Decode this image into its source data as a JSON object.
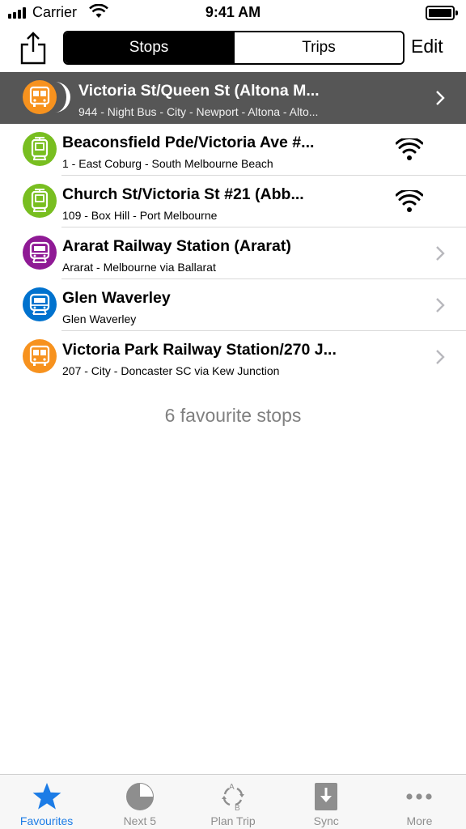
{
  "status_bar": {
    "carrier": "Carrier",
    "time": "9:41 AM"
  },
  "nav": {
    "segments": [
      "Stops",
      "Trips"
    ],
    "selected_segment": "Stops",
    "edit_label": "Edit"
  },
  "stops": [
    {
      "title": "Victoria St/Queen St  (Altona M...",
      "subtitle": "944 - Night Bus - City - Newport - Altona - Alto...",
      "mode": "night-bus",
      "color": "#f7921e",
      "accessory": "chevron",
      "highlighted": true
    },
    {
      "title": "Beaconsfield Pde/Victoria Ave #...",
      "subtitle": "1 - East Coburg - South Melbourne Beach",
      "mode": "tram",
      "color": "#78be20",
      "accessory": "wifi",
      "highlighted": false
    },
    {
      "title": "Church St/Victoria St #21  (Abb...",
      "subtitle": "109 - Box Hill - Port Melbourne",
      "mode": "tram",
      "color": "#78be20",
      "accessory": "wifi",
      "highlighted": false
    },
    {
      "title": "Ararat Railway Station  (Ararat)",
      "subtitle": "Ararat - Melbourne via Ballarat",
      "mode": "regional-train",
      "color": "#8f1a95",
      "accessory": "chevron",
      "highlighted": false
    },
    {
      "title": "Glen Waverley",
      "subtitle": "Glen Waverley",
      "mode": "train",
      "color": "#0072ce",
      "accessory": "chevron",
      "highlighted": false
    },
    {
      "title": "Victoria Park Railway Station/270 J...",
      "subtitle": "207 - City - Doncaster SC via Kew Junction",
      "mode": "bus",
      "color": "#f7921e",
      "accessory": "chevron",
      "highlighted": false
    }
  ],
  "footer_count": "6 favourite stops",
  "tabs": [
    {
      "label": "Favourites",
      "icon": "star-icon",
      "active": true
    },
    {
      "label": "Next 5",
      "icon": "pie-clock-icon",
      "active": false
    },
    {
      "label": "Plan Trip",
      "icon": "plan-trip-icon",
      "active": false
    },
    {
      "label": "Sync",
      "icon": "sync-download-icon",
      "active": false
    },
    {
      "label": "More",
      "icon": "more-dots-icon",
      "active": false
    }
  ],
  "colors": {
    "accent": "#1c7ce6",
    "highlight_row": "#565656",
    "inactive_tab": "#8e8e8e"
  }
}
